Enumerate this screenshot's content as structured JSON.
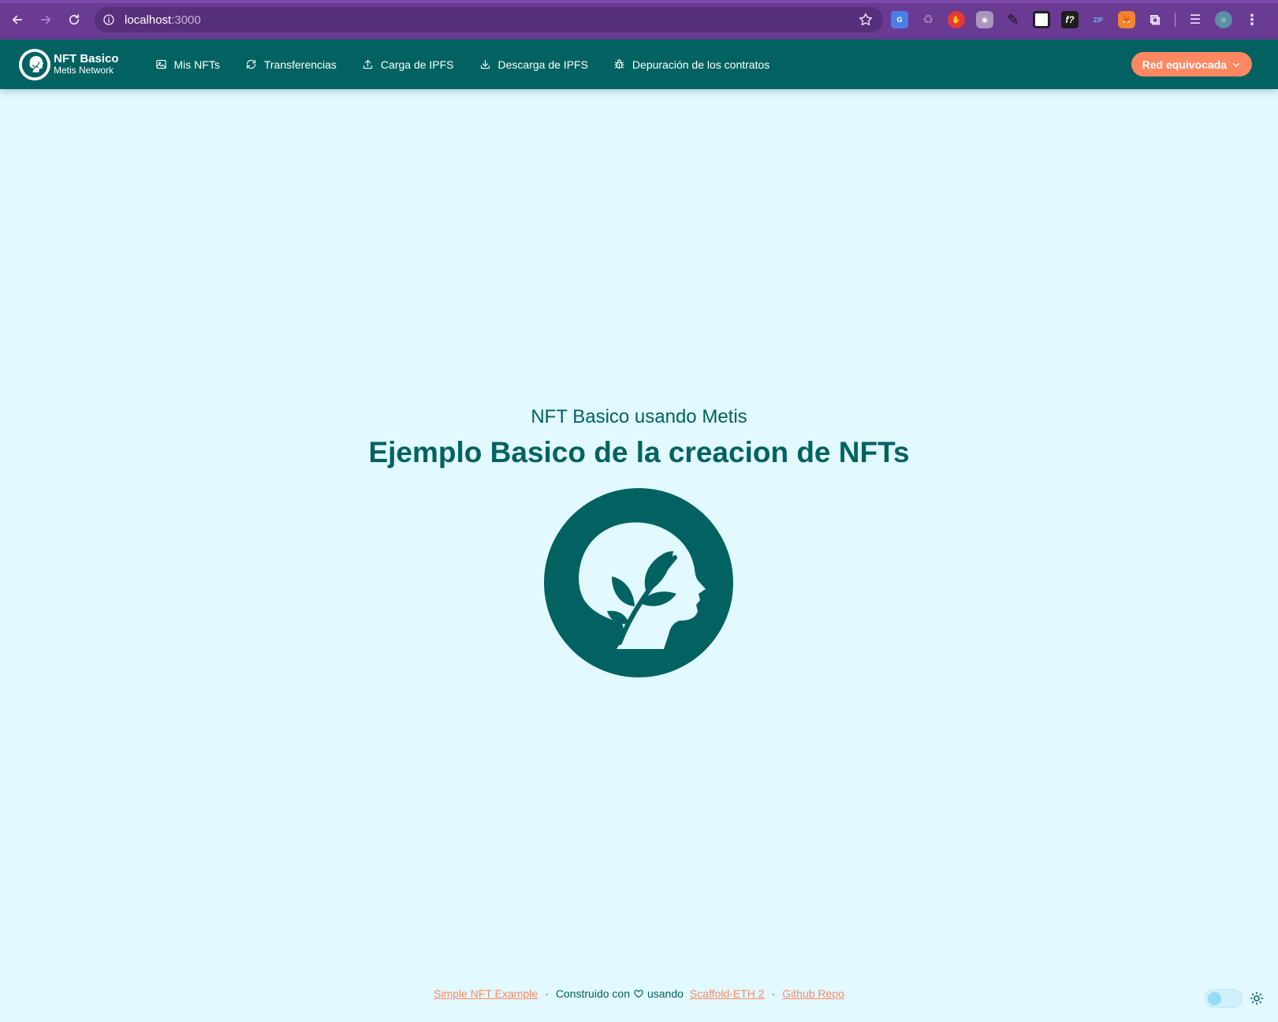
{
  "browser": {
    "url_host": "localhost",
    "url_port": ":3000"
  },
  "header": {
    "brand_title": "NFT Basico",
    "brand_subtitle": "Metis Network",
    "menu": [
      {
        "label": "Mis NFTs",
        "icon": "image-icon"
      },
      {
        "label": "Transferencias",
        "icon": "refresh-icon"
      },
      {
        "label": "Carga de IPFS",
        "icon": "upload-icon"
      },
      {
        "label": "Descarga de IPFS",
        "icon": "download-icon"
      },
      {
        "label": "Depuración de los contratos",
        "icon": "bug-icon"
      }
    ],
    "network_button": "Red equivocada"
  },
  "hero": {
    "subtitle": "NFT Basico usando Metis",
    "title": "Ejemplo Basico de la creacion de NFTs"
  },
  "footer": {
    "link_example": "Simple NFT Example",
    "separator": "·",
    "built_with": "Construido con",
    "using": "usando",
    "link_scaffold": "Scaffold-ETH 2",
    "link_github": "Github Repo"
  },
  "colors": {
    "browser_frame": "#6a3b93",
    "header_bg": "#026262",
    "page_bg": "#e1f9ff",
    "accent": "#ff8863",
    "primary_text": "#026262"
  }
}
